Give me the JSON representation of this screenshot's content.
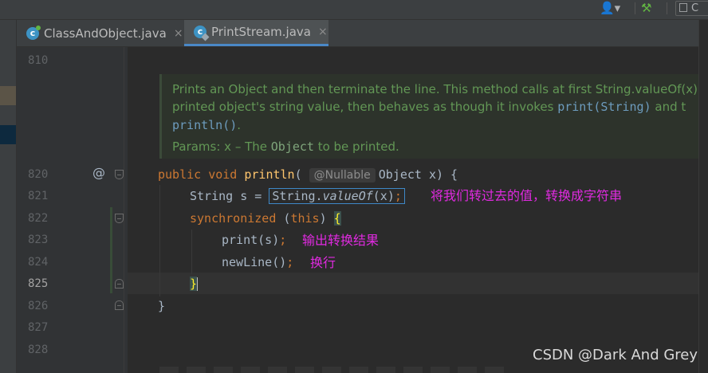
{
  "toolbar": {
    "icons": [
      "user-icon",
      "hammer-icon"
    ],
    "partial_label": "C"
  },
  "tabs": [
    {
      "label": "ClassAndObject.java",
      "icon": "java-class-icon",
      "active": false
    },
    {
      "label": "PrintStream.java",
      "icon": "java-class-icon",
      "active": true
    }
  ],
  "tab_close_glyph": "×",
  "line_numbers": [
    "810",
    "820",
    "821",
    "822",
    "823",
    "824",
    "825",
    "826",
    "827",
    "828"
  ],
  "current_line": "825",
  "doc": {
    "line1": "Prints an Object and then terminate the line. This method calls at first String.valueOf(x)",
    "line2_text": "printed object's string value, then behaves as though it invokes ",
    "line2_code1": "print(String)",
    "line2_tail": " and t",
    "line3_code": "println()",
    "line3_tail": ".",
    "params_prefix": "Params: x – The ",
    "params_code": "Object",
    "params_suffix": " to be printed."
  },
  "code": {
    "l820_kw1": "public",
    "l820_kw2": "void",
    "l820_fn": "println",
    "l820_open": "(",
    "l820_hint": "@Nullable",
    "l820_rest": "Object x) {",
    "l821_pre": "String s = ",
    "l821_box_a": "String.",
    "l821_box_b": "valueOf",
    "l821_box_c": "(x)",
    "l821_semi": ";",
    "l822_kw": "synchronized",
    "l822_mid": " (",
    "l822_this": "this",
    "l822_close": ") ",
    "l822_brace": "{",
    "l823_text": "print(s)",
    "l823_semi": ";",
    "l824_text": "newLine()",
    "l824_semi": ";",
    "l825_brace": "}",
    "l826_brace": "}"
  },
  "annotations": {
    "a821": "将我们转过去的值，转换成字符串",
    "a823": "输出转换结果",
    "a824": "换行"
  },
  "watermark": "CSDN @Dark And Grey",
  "colors": {
    "keyword": "#cc7832",
    "method": "#ffc66d",
    "doc_text": "#629755",
    "annotation": "#e02ae0",
    "tab_underline": "#4a88c7"
  }
}
